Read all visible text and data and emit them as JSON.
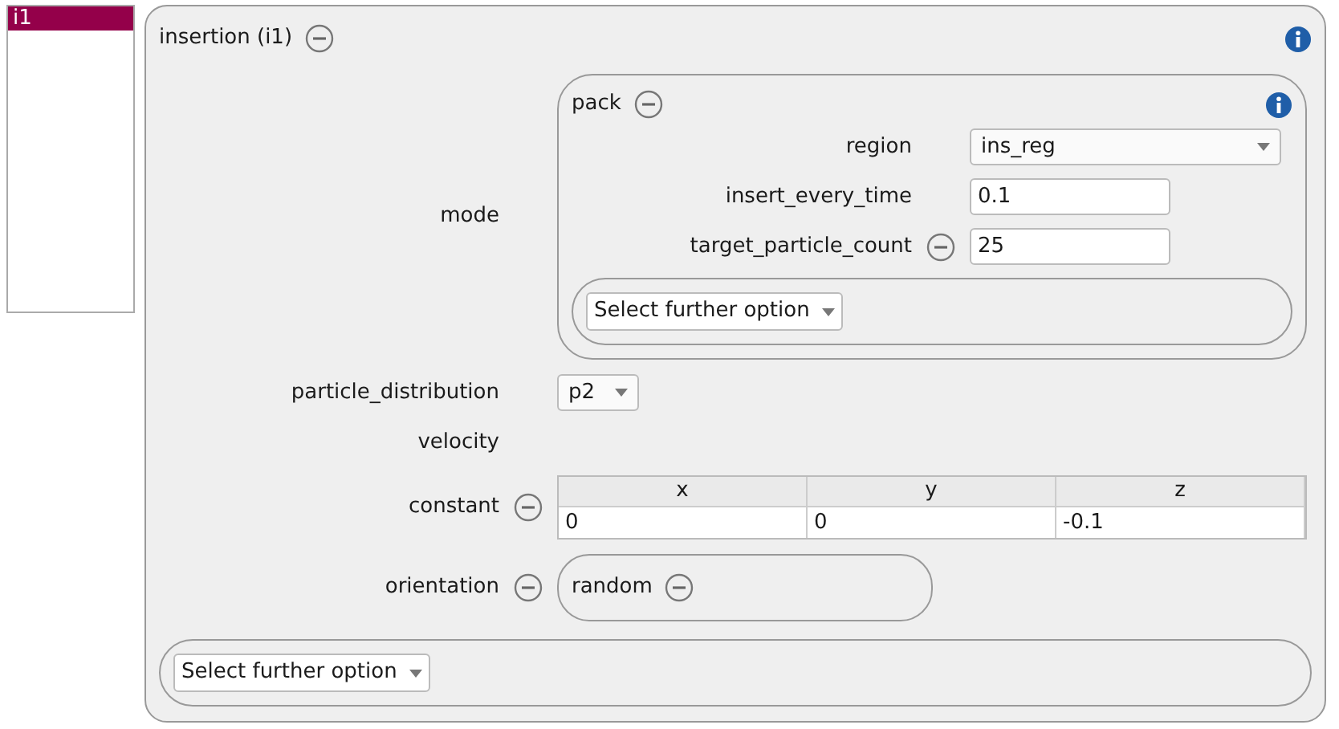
{
  "list": [
    {
      "label": "i1",
      "selected": true
    }
  ],
  "panel": {
    "title": "insertion (i1)",
    "removable": true,
    "info": true,
    "rows": [
      {
        "kind": "group",
        "label": "mode",
        "removable": false,
        "group": {
          "title": "pack",
          "removable": true,
          "info": true,
          "further_option": "Select further option",
          "fields": [
            {
              "kind": "dropdown",
              "label": "region",
              "removable": false,
              "value": "ins_reg"
            },
            {
              "kind": "text",
              "label": "insert_every_time",
              "removable": false,
              "value": "0.1"
            },
            {
              "kind": "text",
              "label": "target_particle_count",
              "removable": true,
              "value": "25"
            }
          ]
        }
      },
      {
        "kind": "dropdown",
        "label": "particle_distribution",
        "removable": false,
        "value": "p2"
      },
      {
        "kind": "heading",
        "label": "velocity",
        "removable": false
      },
      {
        "kind": "table",
        "label": "constant",
        "removable": true,
        "columns": [
          "x",
          "y",
          "z"
        ],
        "values": [
          "0",
          "0",
          "-0.1"
        ]
      },
      {
        "kind": "group",
        "label": "orientation",
        "removable": true,
        "group": {
          "title": "random",
          "removable": true,
          "info": false
        }
      }
    ],
    "further_option": "Select further option"
  }
}
